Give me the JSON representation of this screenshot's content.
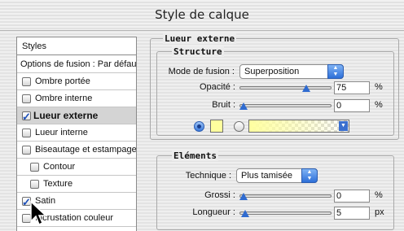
{
  "window": {
    "title": "Style de calque"
  },
  "styles_panel": {
    "header": "Styles",
    "blending_options": "Options de fusion : Par défaut",
    "items": [
      {
        "label": "Ombre portée",
        "checked": false,
        "selected": false
      },
      {
        "label": "Ombre interne",
        "checked": false,
        "selected": false
      },
      {
        "label": "Lueur externe",
        "checked": true,
        "selected": true
      },
      {
        "label": "Lueur interne",
        "checked": false,
        "selected": false
      },
      {
        "label": "Biseautage et estampage",
        "checked": false,
        "selected": false
      },
      {
        "label": "Contour",
        "checked": false,
        "selected": false
      },
      {
        "label": "Texture",
        "checked": false,
        "selected": false
      },
      {
        "label": "Satin",
        "checked": true,
        "selected": false
      },
      {
        "label": "Incrustation couleur",
        "checked": false,
        "selected": false
      }
    ]
  },
  "outer_glow": {
    "section_title": "Lueur externe",
    "structure": {
      "title": "Structure",
      "blend_mode_label": "Mode de fusion :",
      "blend_mode_value": "Superposition",
      "opacity_label": "Opacité :",
      "opacity_value": "75",
      "opacity_unit": "%",
      "opacity_level": 0.75,
      "noise_label": "Bruit :",
      "noise_value": "0",
      "noise_unit": "%",
      "noise_level": 0,
      "color_mode": "solid",
      "solid_color": "#ffff9e",
      "gradient_start": "#ffffa0"
    },
    "elements": {
      "title": "Eléments",
      "technique_label": "Technique :",
      "technique_value": "Plus tamisée",
      "spread_label": "Grossi :",
      "spread_value": "0",
      "spread_unit": "%",
      "spread_level": 0,
      "size_label": "Longueur :",
      "size_value": "5",
      "size_unit": "px",
      "size_level": 0.02
    }
  },
  "icons": {
    "cursor": "arrow-cursor-icon",
    "popup_arrows": "updown-arrows-icon",
    "dropdown": "triangle-down-icon"
  }
}
